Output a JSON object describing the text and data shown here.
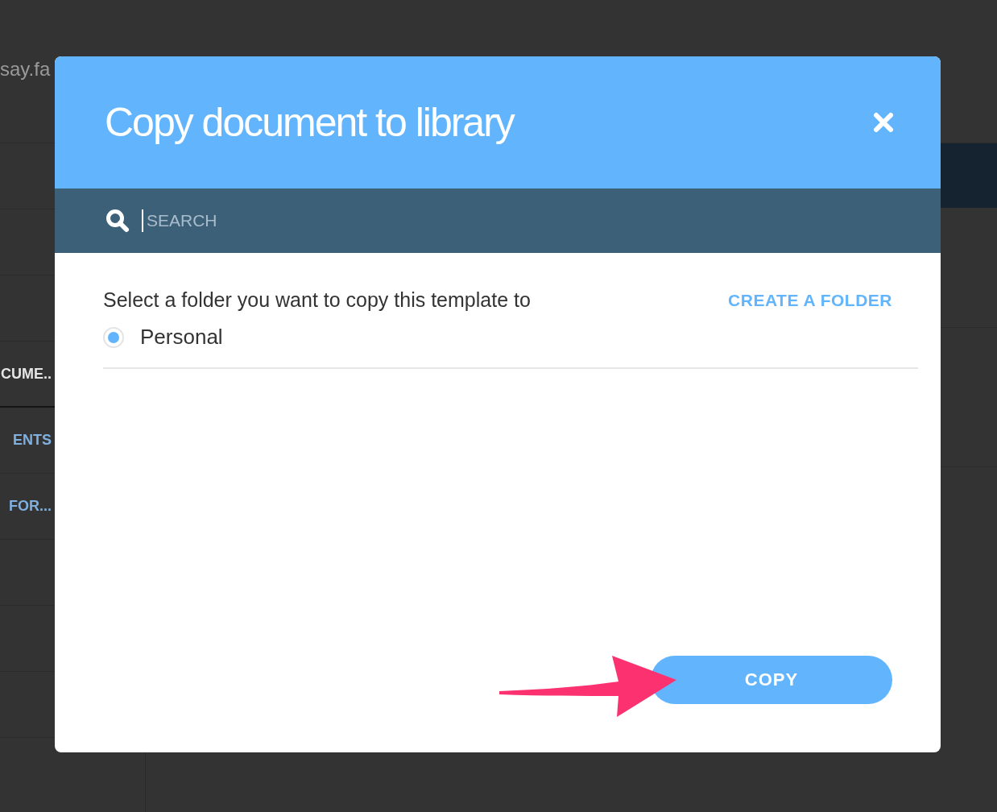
{
  "background": {
    "header_text": "say.fa",
    "sidebar_items": [
      {
        "label": "CUME..",
        "selected": true
      },
      {
        "label": "ENTS",
        "selected": false
      },
      {
        "label": "FOR...",
        "selected": false
      }
    ]
  },
  "dialog": {
    "title": "Copy document to library",
    "search": {
      "placeholder": "SEARCH"
    },
    "prompt": "Select a folder you want to copy this template to",
    "create_link": "CREATE A FOLDER",
    "folders": [
      {
        "label": "Personal",
        "selected": true
      }
    ],
    "copy_button": "COPY"
  }
}
